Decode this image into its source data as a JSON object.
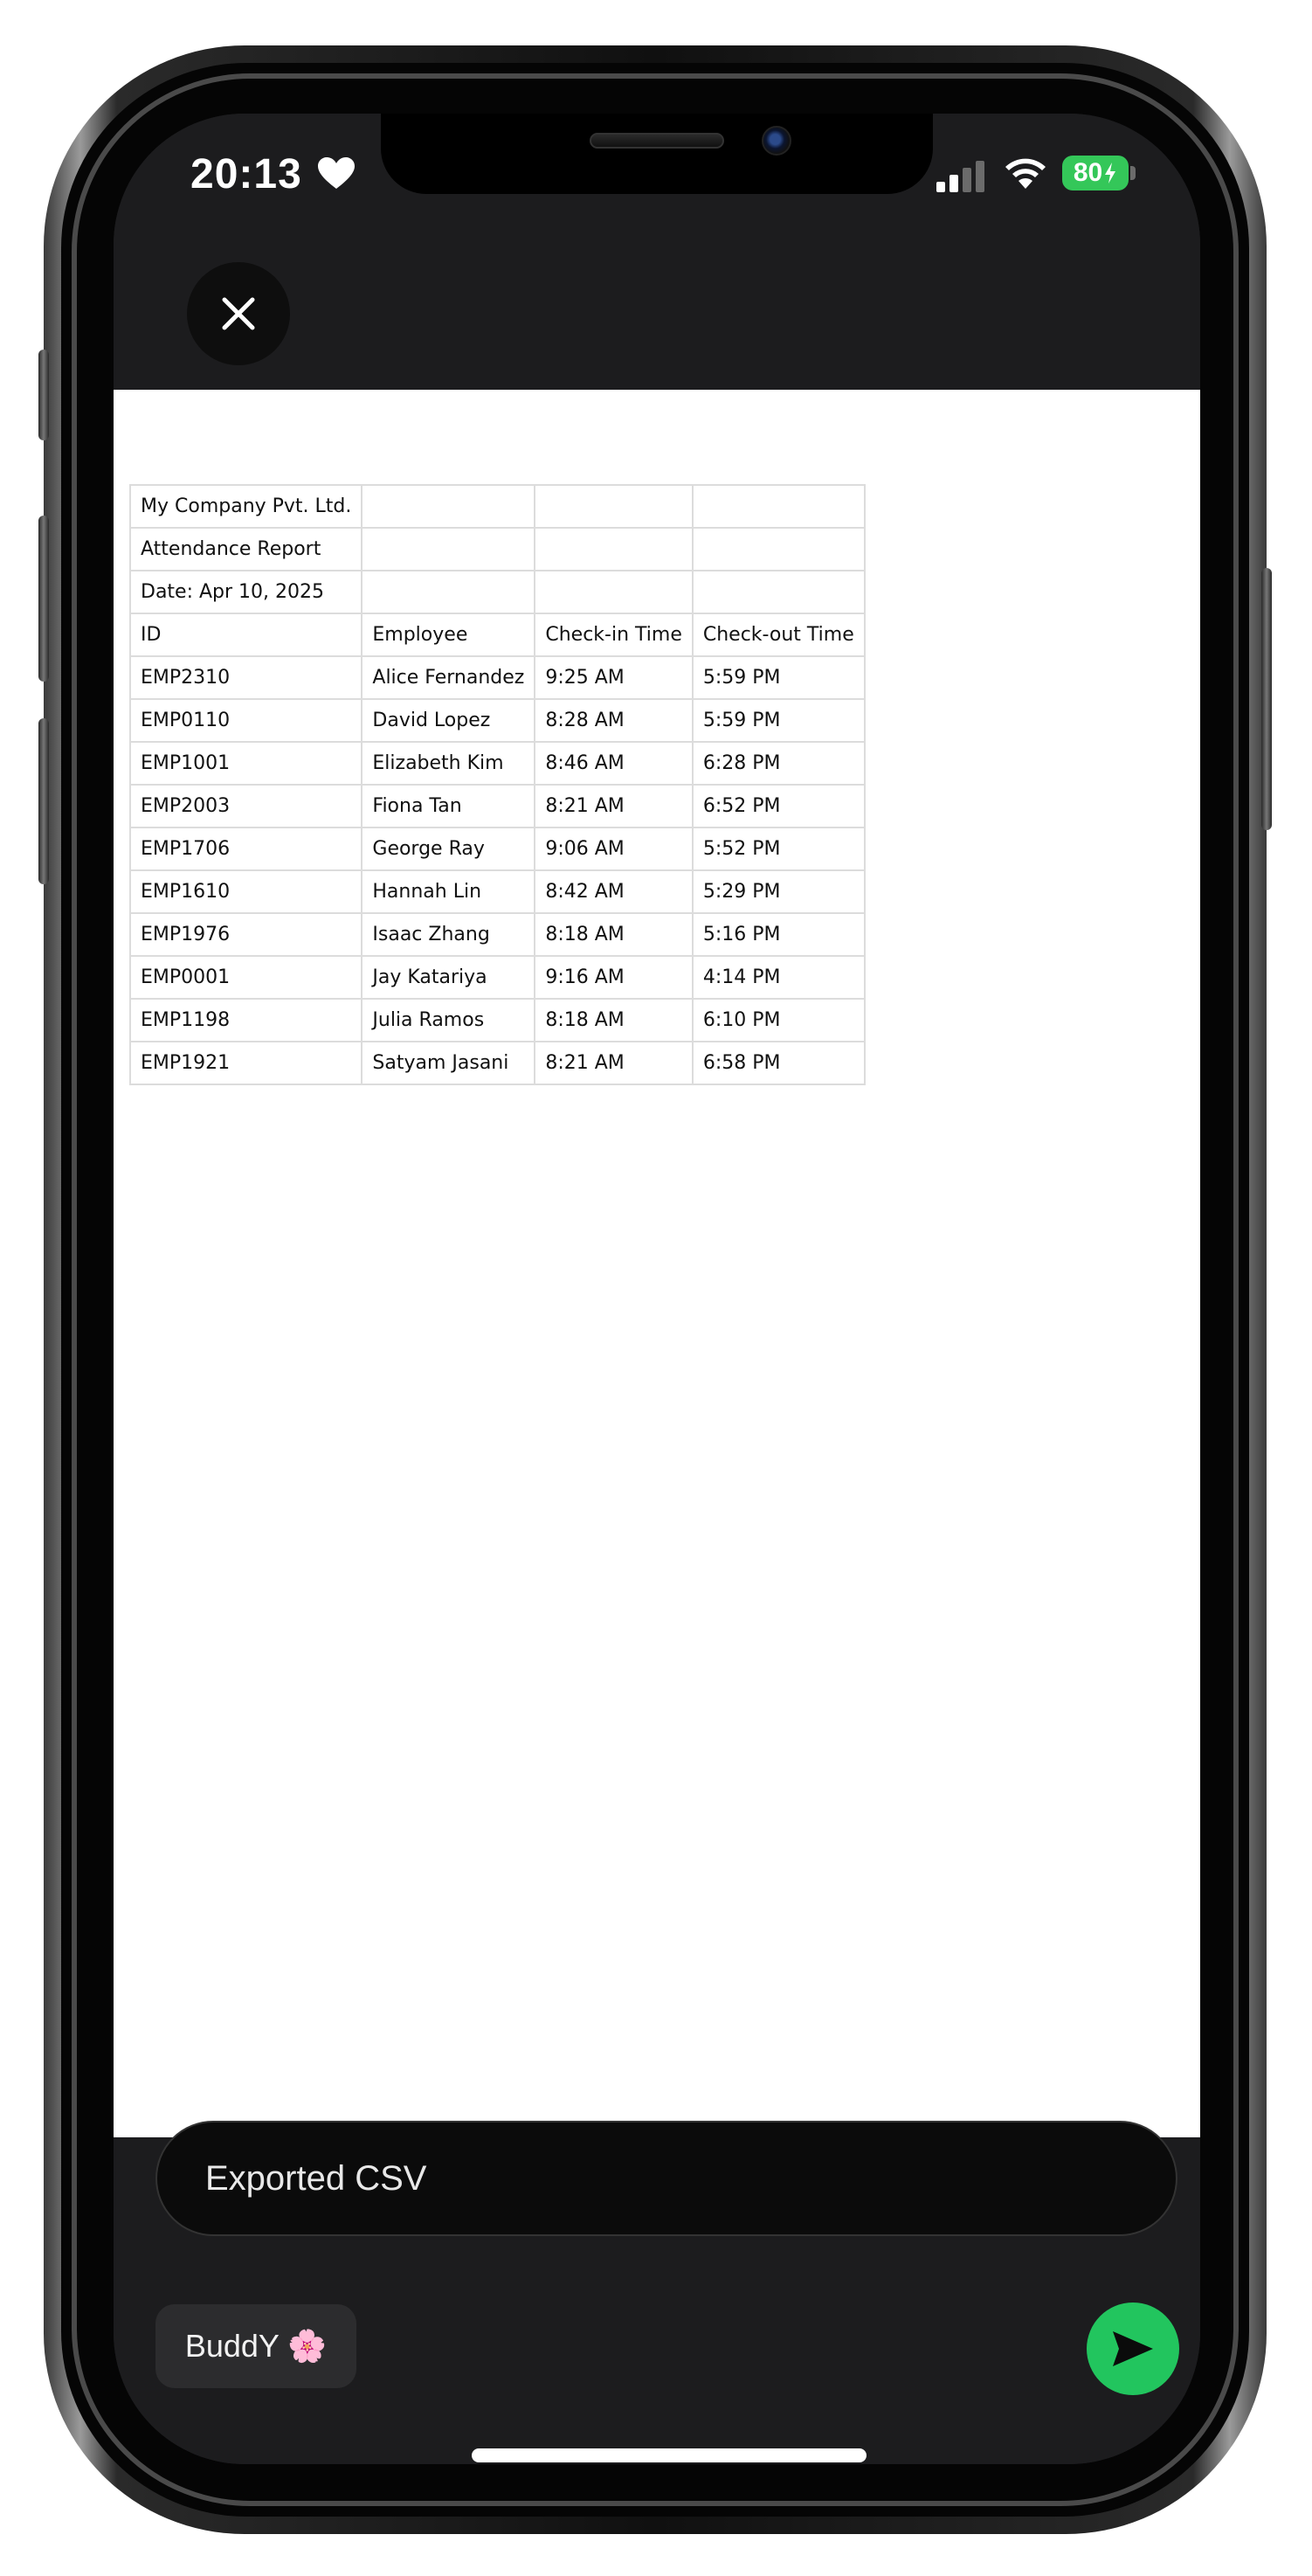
{
  "status_bar": {
    "time": "20:13",
    "battery": "80",
    "icons": [
      "heart-icon",
      "cellular-signal-icon",
      "wifi-icon",
      "battery-charging-icon"
    ]
  },
  "header": {
    "close_icon": "close-icon"
  },
  "sheet": {
    "rows": [
      [
        "My Company Pvt. Ltd.",
        "",
        "",
        ""
      ],
      [
        "Attendance Report",
        "",
        "",
        ""
      ],
      [
        "Date: Apr 10, 2025",
        "",
        "",
        ""
      ],
      [
        "ID",
        "Employee",
        "Check-in Time",
        "Check-out Time"
      ],
      [
        "EMP2310",
        "Alice Fernandez",
        "9:25 AM",
        "5:59 PM"
      ],
      [
        "EMP0110",
        "David Lopez",
        "8:28 AM",
        "5:59 PM"
      ],
      [
        "EMP1001",
        "Elizabeth Kim",
        "8:46 AM",
        "6:28 PM"
      ],
      [
        "EMP2003",
        "Fiona Tan",
        "8:21 AM",
        "6:52 PM"
      ],
      [
        "EMP1706",
        "George Ray",
        "9:06 AM",
        "5:52 PM"
      ],
      [
        "EMP1610",
        "Hannah Lin",
        "8:42 AM",
        "5:29 PM"
      ],
      [
        "EMP1976",
        "Isaac Zhang",
        "8:18 AM",
        "5:16 PM"
      ],
      [
        "EMP0001",
        "Jay Katariya",
        "9:16 AM",
        "4:14 PM"
      ],
      [
        "EMP1198",
        "Julia Ramos",
        "8:18 AM",
        "6:10 PM"
      ],
      [
        "EMP1921",
        "Satyam Jasani",
        "8:21 AM",
        "6:58 PM"
      ]
    ]
  },
  "composer": {
    "caption": "Exported CSV",
    "recipient": "BuddY 🌸",
    "send_icon": "send-icon"
  },
  "colors": {
    "accent_green": "#22c55e",
    "battery_green": "#34c759",
    "dark_surface": "#1c1c1e"
  }
}
